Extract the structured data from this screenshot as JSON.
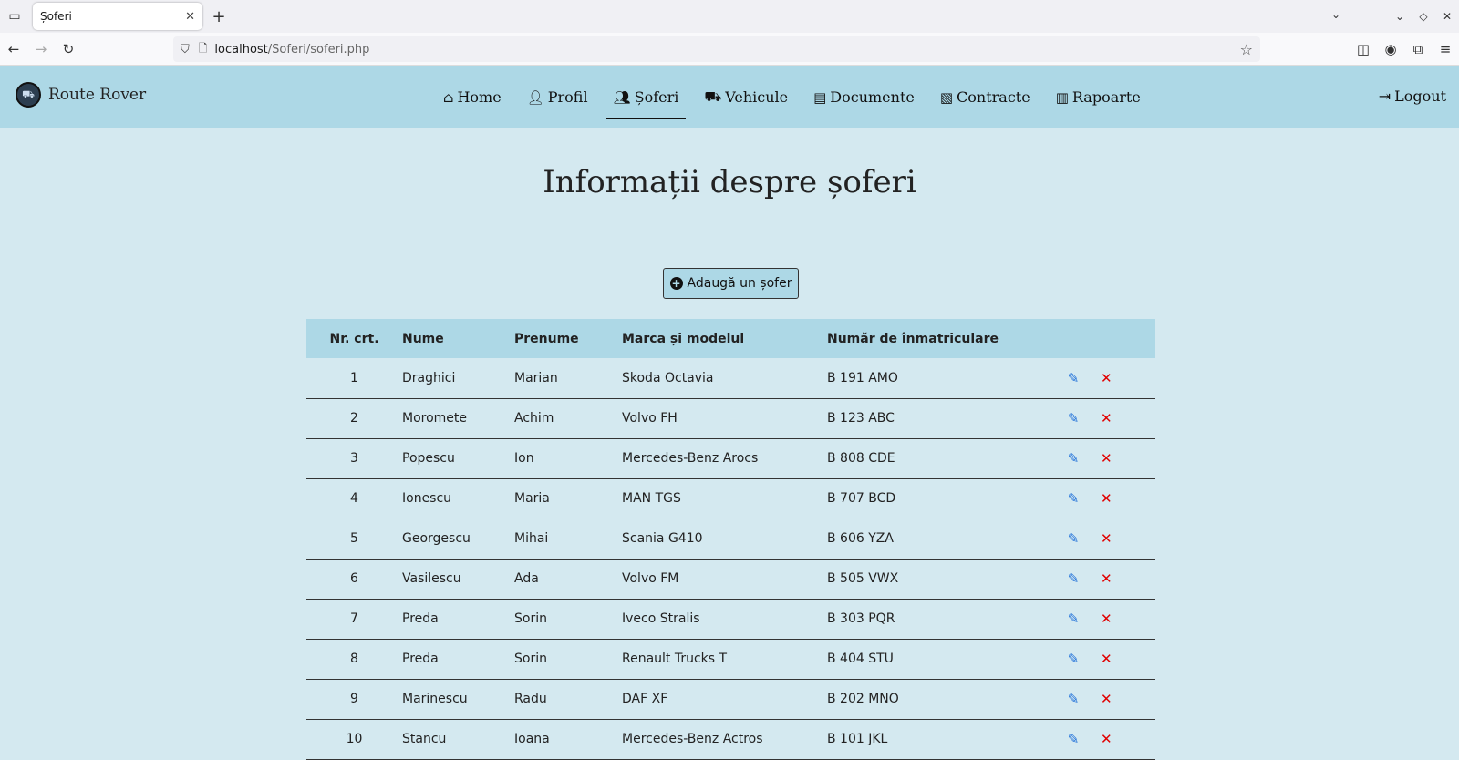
{
  "browser": {
    "tab_title": "Șoferi",
    "url_host": "localhost",
    "url_path": "/Soferi/soferi.php"
  },
  "site": {
    "brand": "Route Rover",
    "nav": [
      {
        "label": "Home",
        "icon": "home-icon"
      },
      {
        "label": "Profil",
        "icon": "user-icon"
      },
      {
        "label": "Șoferi",
        "icon": "users-icon"
      },
      {
        "label": "Vehicule",
        "icon": "truck-icon"
      },
      {
        "label": "Documente",
        "icon": "document-icon"
      },
      {
        "label": "Contracte",
        "icon": "contract-icon"
      },
      {
        "label": "Rapoarte",
        "icon": "chart-icon"
      }
    ],
    "active_nav": "Șoferi",
    "logout": "Logout"
  },
  "main": {
    "title": "Informații despre șoferi",
    "add_button": "Adaugă un șofer",
    "table": {
      "headers": [
        "Nr. crt.",
        "Nume",
        "Prenume",
        "Marca și modelul",
        "Număr de înmatriculare"
      ],
      "rows": [
        [
          "1",
          "Draghici",
          "Marian",
          "Skoda Octavia",
          "B 191 AMO"
        ],
        [
          "2",
          "Moromete",
          "Achim",
          "Volvo FH",
          "B 123 ABC"
        ],
        [
          "3",
          "Popescu",
          "Ion",
          "Mercedes-Benz Arocs",
          "B 808 CDE"
        ],
        [
          "4",
          "Ionescu",
          "Maria",
          "MAN TGS",
          "B 707 BCD"
        ],
        [
          "5",
          "Georgescu",
          "Mihai",
          "Scania G410",
          "B 606 YZA"
        ],
        [
          "6",
          "Vasilescu",
          "Ada",
          "Volvo FM",
          "B 505 VWX"
        ],
        [
          "7",
          "Preda",
          "Sorin",
          "Iveco Stralis",
          "B 303 PQR"
        ],
        [
          "8",
          "Preda",
          "Sorin",
          "Renault Trucks T",
          "B 404 STU"
        ],
        [
          "9",
          "Marinescu",
          "Radu",
          "DAF XF",
          "B 202 MNO"
        ],
        [
          "10",
          "Stancu",
          "Ioana",
          "Mercedes-Benz Actros",
          "B 101 JKL"
        ]
      ]
    }
  },
  "colors": {
    "header_bg": "#add8e6",
    "page_bg": "#d4e9f0",
    "edit_icon": "#1e6fd9",
    "delete_icon": "#e10000"
  }
}
